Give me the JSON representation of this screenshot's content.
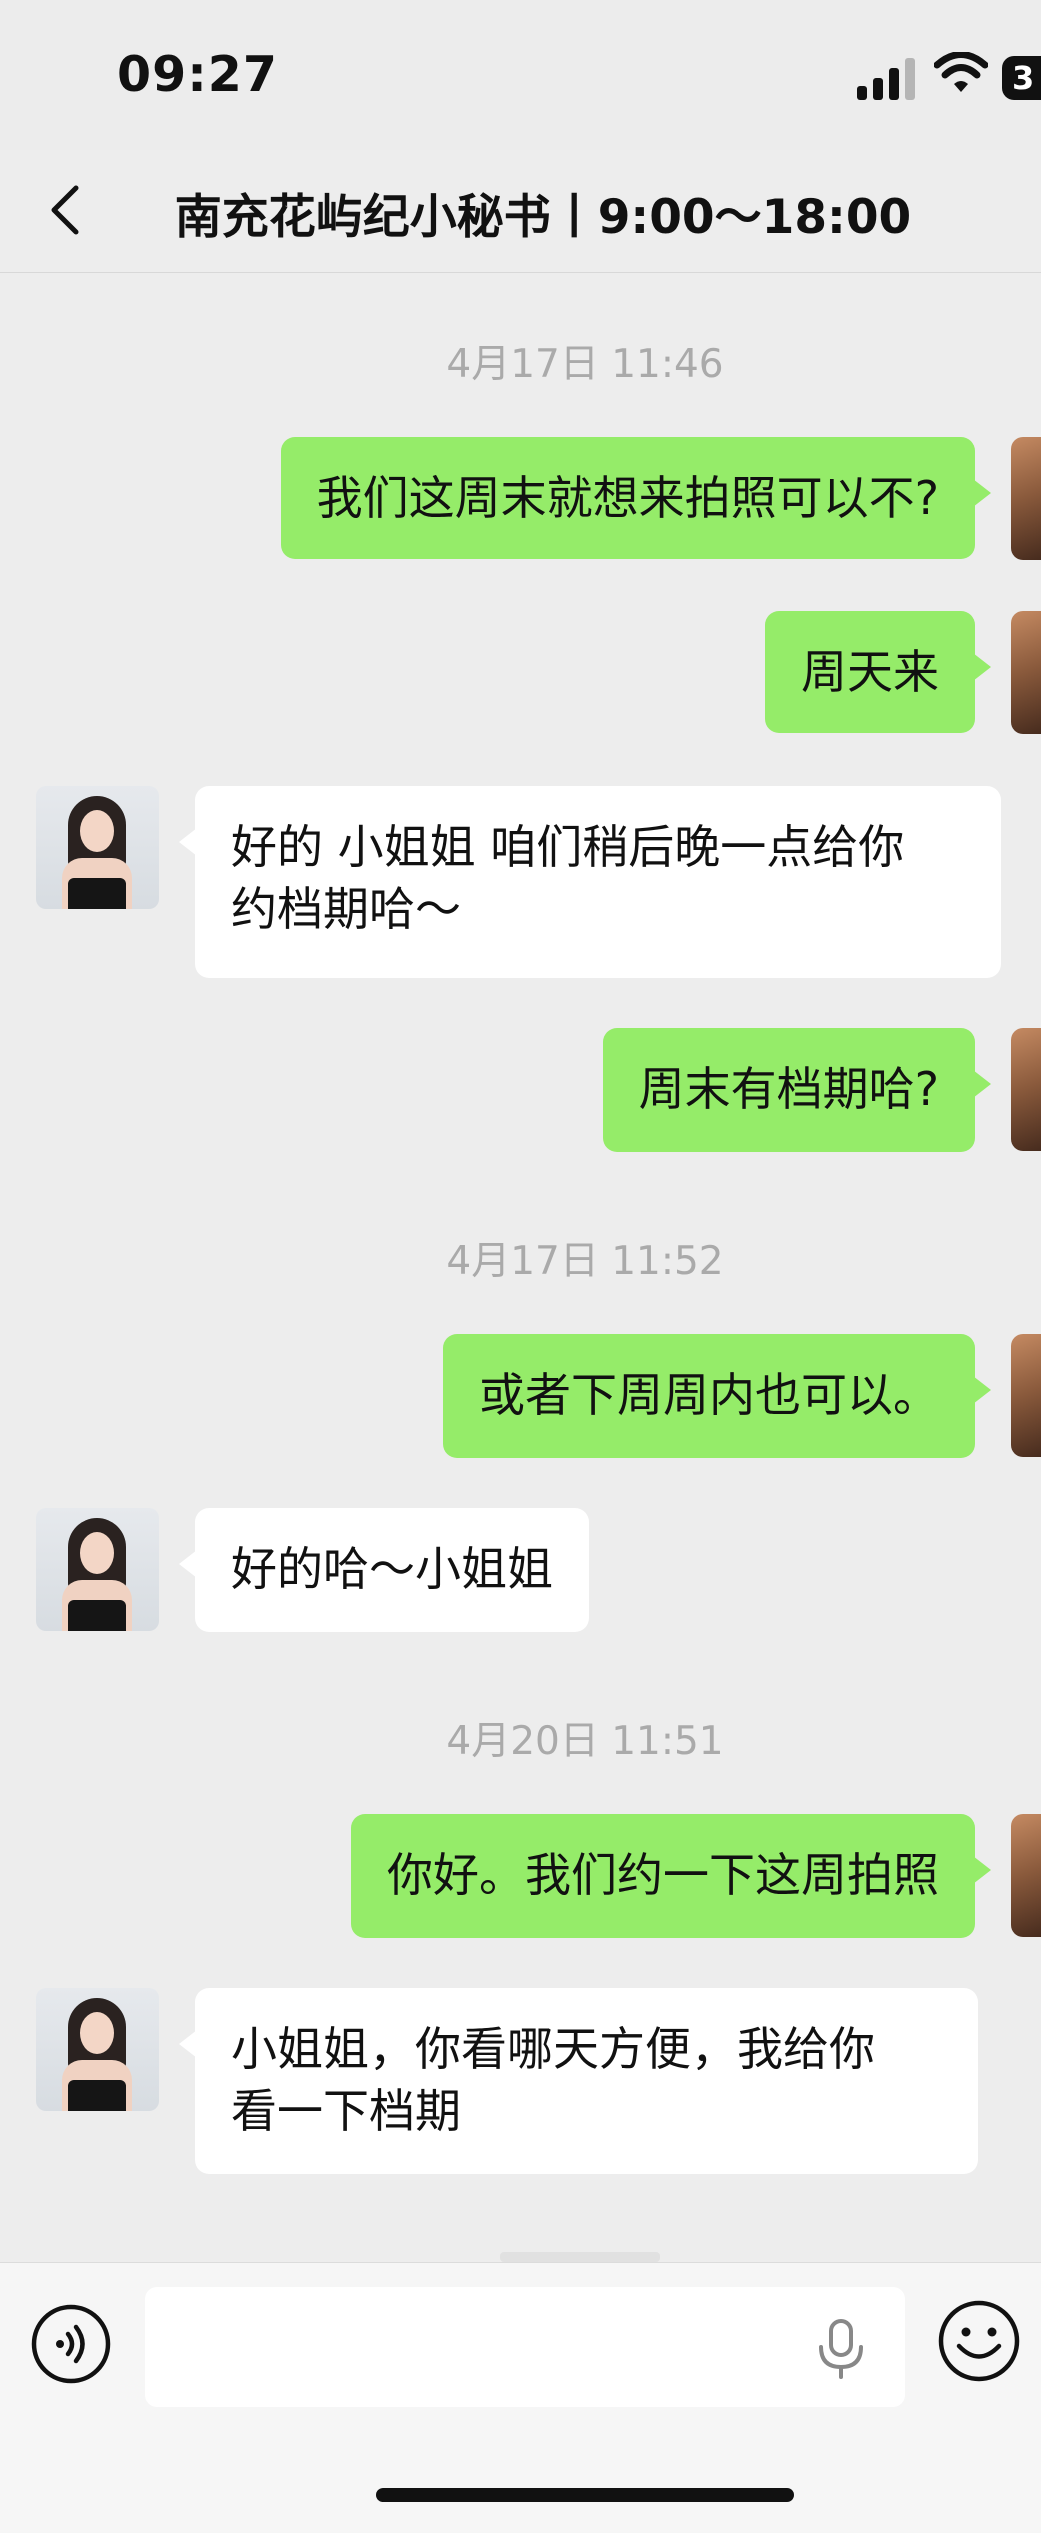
{
  "status_bar": {
    "time": "09:27",
    "battery": "3"
  },
  "header": {
    "title": "南充花屿纪小秘书丨9:00～18:00"
  },
  "messages": [
    {
      "type": "timestamp",
      "text": "4月17日 11:46"
    },
    {
      "type": "sent",
      "text": "我们这周末就想来拍照可以不?"
    },
    {
      "type": "sent",
      "text": "周天来"
    },
    {
      "type": "received",
      "lines": [
        "好的 小姐姐 咱们稍后晚一点给你",
        "约档期哈～"
      ]
    },
    {
      "type": "sent",
      "text": "周末有档期哈?"
    },
    {
      "type": "timestamp",
      "text": "4月17日 11:52"
    },
    {
      "type": "sent",
      "text": "或者下周周内也可以。"
    },
    {
      "type": "received",
      "lines": [
        "好的哈～小姐姐"
      ]
    },
    {
      "type": "timestamp",
      "text": "4月20日 11:51"
    },
    {
      "type": "sent",
      "text": "你好。我们约一下这周拍照"
    },
    {
      "type": "received",
      "lines": [
        "小姐姐，你看哪天方便，我给你",
        "看一下档期"
      ]
    }
  ],
  "icons": {
    "back": "chevron-left-icon",
    "voice": "voice-mode-icon",
    "mic": "microphone-icon",
    "emoji": "emoji-icon"
  }
}
